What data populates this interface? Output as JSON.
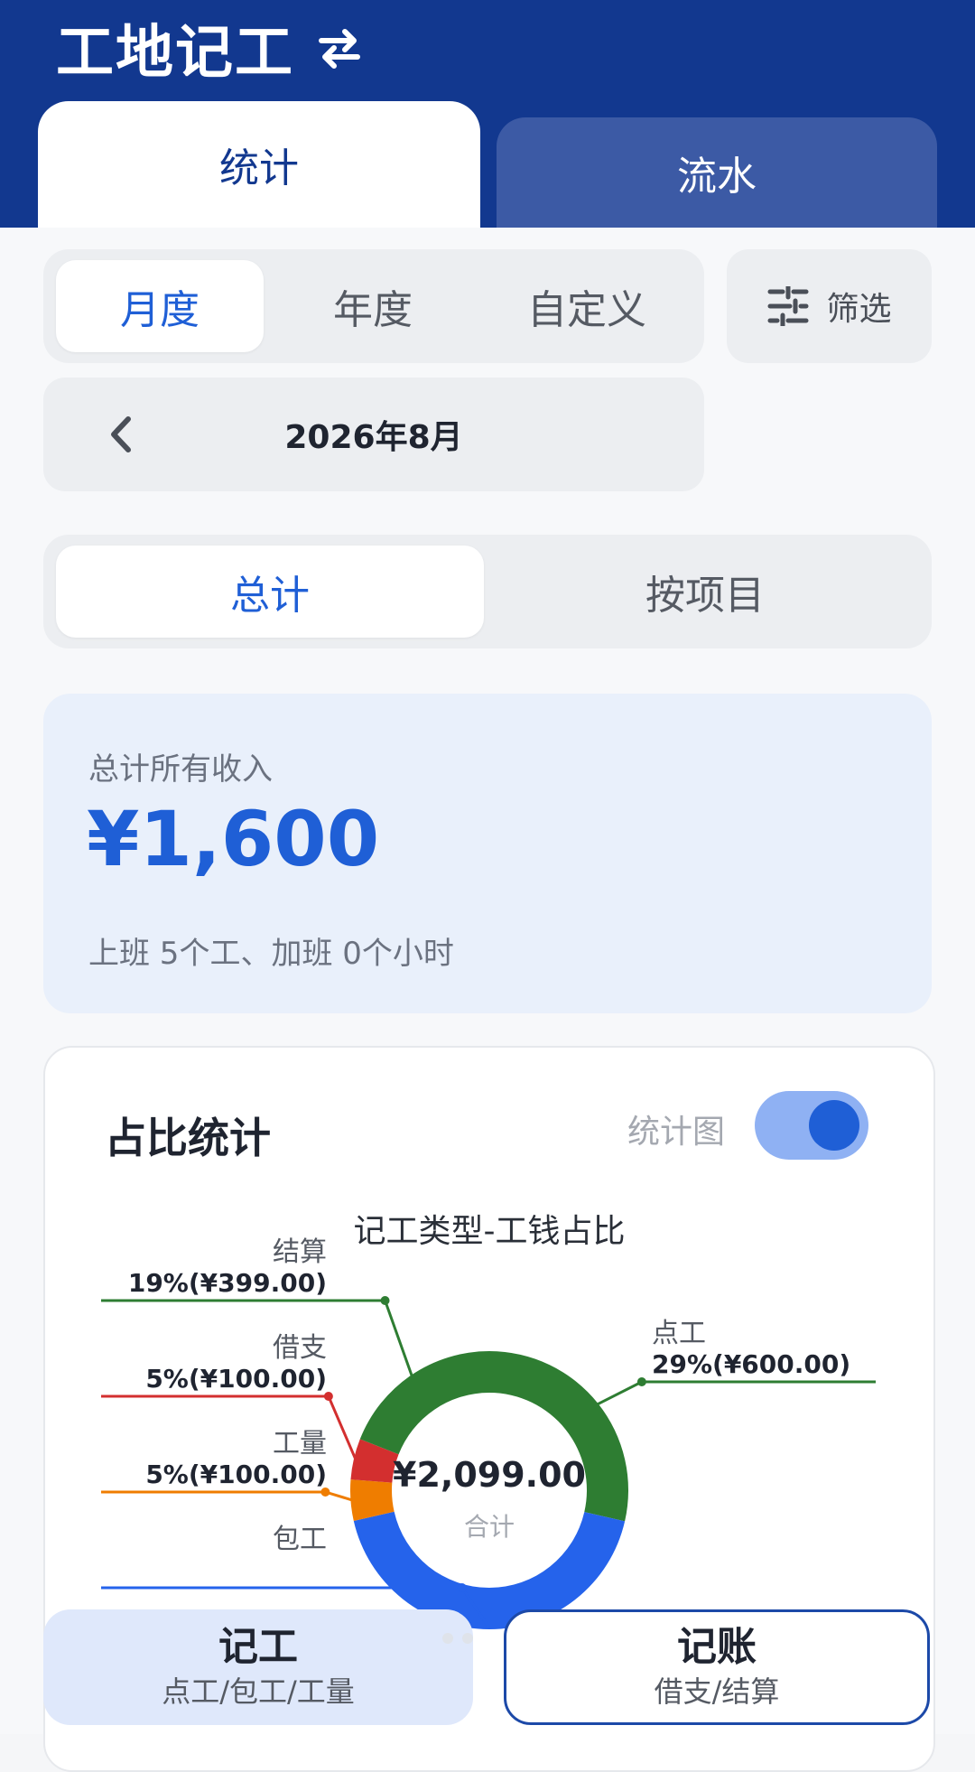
{
  "header": {
    "app_title": "工地记工"
  },
  "main_tabs": [
    {
      "label": "统计",
      "active": true
    },
    {
      "label": "流水",
      "active": false
    }
  ],
  "period_tabs": [
    {
      "label": "月度",
      "active": true
    },
    {
      "label": "年度",
      "active": false
    },
    {
      "label": "自定义",
      "active": false
    }
  ],
  "filter": {
    "label": "筛选"
  },
  "date": {
    "label": "2026年8月"
  },
  "scope_tabs": [
    {
      "label": "总计",
      "active": true
    },
    {
      "label": "按项目",
      "active": false
    }
  ],
  "income": {
    "label": "总计所有收入",
    "amount": "¥1,600",
    "summary": "上班 5个工、加班 0个小时"
  },
  "ratio": {
    "title": "占比统计",
    "toggle_label": "统计图",
    "toggle_on": true,
    "chart_title": "记工类型-工钱占比"
  },
  "chart_data": {
    "type": "pie",
    "title": "记工类型-工钱占比",
    "center_value": "¥2,099.00",
    "center_label": "合计",
    "slices": [
      {
        "name": "点工",
        "percent": 29,
        "amount": "¥600.00",
        "value": 600,
        "color": "#2e7d32",
        "label": "29%(¥600.00)"
      },
      {
        "name": "包工",
        "percent": 43,
        "amount": "¥900.00",
        "value": 900,
        "color": "#2563eb",
        "label": ""
      },
      {
        "name": "工量",
        "percent": 5,
        "amount": "¥100.00",
        "value": 100,
        "color": "#ef7d00",
        "label": "5%(¥100.00)"
      },
      {
        "name": "借支",
        "percent": 5,
        "amount": "¥100.00",
        "value": 100,
        "color": "#d32f2f",
        "label": "5%(¥100.00)"
      },
      {
        "name": "结算",
        "percent": 19,
        "amount": "¥399.00",
        "value": 399,
        "color": "#2e7d32",
        "label": "19%(¥399.00)"
      }
    ]
  },
  "bottom_actions": [
    {
      "title": "记工",
      "subtitle": "点工/包工/工量"
    },
    {
      "title": "记账",
      "subtitle": "借支/结算"
    }
  ],
  "colors": {
    "brand": "#12388f",
    "accent": "#1f5fd6"
  }
}
